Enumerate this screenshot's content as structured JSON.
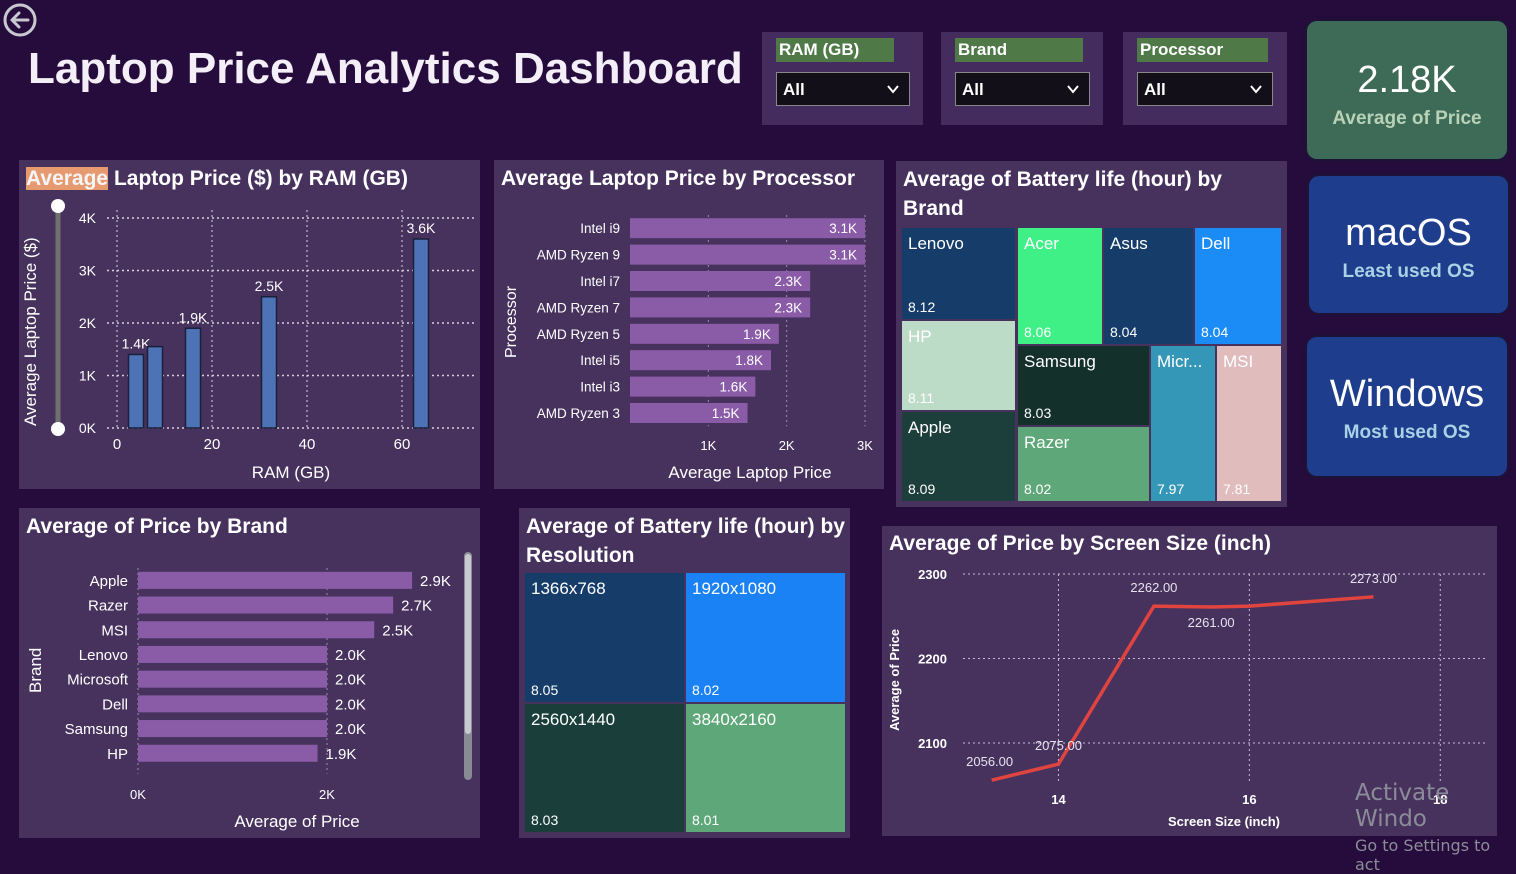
{
  "dashboard_title": "Laptop Price Analytics Dashboard",
  "slicers": [
    {
      "label": "RAM (GB)",
      "value": "All"
    },
    {
      "label": "Brand",
      "value": "All"
    },
    {
      "label": "Processor",
      "value": "All"
    }
  ],
  "kpis": [
    {
      "value": "2.18K",
      "label": "Average of Price",
      "bg": "#3e6b57",
      "label_color": "#b8d2b8"
    },
    {
      "value": "macOS",
      "label": "Least used OS",
      "bg": "#1e3d8c",
      "label_color": "#a9d2e6"
    },
    {
      "value": "Windows",
      "label": "Most used OS",
      "bg": "#1e3d8c",
      "label_color": "#a9d2e6"
    }
  ],
  "ram_chart": {
    "title_highlight": "Average",
    "title_rest": " Laptop Price ($) by RAM (GB)",
    "xlabel": "RAM (GB)",
    "ylabel": "Average Laptop Price ($)",
    "yticks": [
      "0K",
      "1K",
      "2K",
      "3K",
      "4K"
    ],
    "xticks": [
      "0",
      "20",
      "40",
      "60"
    ]
  },
  "proc_chart": {
    "title": "Average Laptop Price by Processor",
    "xlabel": "Average Laptop Price",
    "ylabel": "Processor",
    "xticks": [
      "1K",
      "2K",
      "3K"
    ]
  },
  "battery_brand": {
    "title": "Average of Battery life (hour) by Brand",
    "tiles": [
      {
        "label": "Lenovo",
        "value": "8.12",
        "color": "#163d6a"
      },
      {
        "label": "Acer",
        "value": "8.06",
        "color": "#3ff087"
      },
      {
        "label": "Asus",
        "value": "8.04",
        "color": "#163d6a"
      },
      {
        "label": "Dell",
        "value": "8.04",
        "color": "#1b8cf6"
      },
      {
        "label": "HP",
        "value": "8.11",
        "color": "#bcdcc8"
      },
      {
        "label": "Samsung",
        "value": "8.03",
        "color": "#13302a"
      },
      {
        "label": "Micr...",
        "value": "7.97",
        "color": "#3597b7"
      },
      {
        "label": "MSI",
        "value": "7.81",
        "color": "#e1bcbd"
      },
      {
        "label": "Apple",
        "value": "8.09",
        "color": "#1c3f3b"
      },
      {
        "label": "Razer",
        "value": "8.02",
        "color": "#5ea778"
      }
    ]
  },
  "brand_chart": {
    "title": "Average of Price by Brand",
    "xlabel": "Average of Price",
    "ylabel": "Brand",
    "xticks": [
      "0K",
      "2K"
    ]
  },
  "battery_res": {
    "title": "Average of Battery life (hour) by Resolution",
    "tiles": [
      {
        "label": "1366x768",
        "value": "8.05",
        "color": "#163d6a"
      },
      {
        "label": "1920x1080",
        "value": "8.02",
        "color": "#1b82f6"
      },
      {
        "label": "2560x1440",
        "value": "8.03",
        "color": "#1a3f3a"
      },
      {
        "label": "3840x2160",
        "value": "8.01",
        "color": "#5ea778"
      }
    ]
  },
  "screen_chart": {
    "title": "Average of Price by Screen Size (inch)",
    "xlabel": "Screen Size (inch)",
    "ylabel": "Average of Price",
    "yticks": [
      "2100",
      "2200",
      "2300"
    ],
    "xticks": [
      "14",
      "16",
      "18"
    ]
  },
  "watermark": {
    "line1": "Activate Windo",
    "line2": "Go to Settings to act"
  },
  "chart_data": [
    {
      "type": "bar",
      "title": "Average Laptop Price ($) by RAM (GB)",
      "xlabel": "RAM (GB)",
      "ylabel": "Average Laptop Price ($)",
      "x": [
        4,
        8,
        16,
        32,
        64
      ],
      "values": [
        1400,
        1550,
        1900,
        2500,
        3600
      ],
      "labels": [
        "1.4K",
        "",
        "1.9K",
        "2.5K",
        "3.6K"
      ],
      "xlim": [
        0,
        72
      ],
      "ylim": [
        0,
        4000
      ],
      "grid": true
    },
    {
      "type": "bar",
      "orientation": "horizontal",
      "title": "Average Laptop Price by Processor",
      "xlabel": "Average Laptop Price",
      "ylabel": "Processor",
      "categories": [
        "Intel i9",
        "AMD Ryzen 9",
        "Intel i7",
        "AMD Ryzen 7",
        "AMD Ryzen 5",
        "Intel i5",
        "Intel i3",
        "AMD Ryzen 3"
      ],
      "values": [
        3100,
        3100,
        2300,
        2300,
        1900,
        1800,
        1600,
        1500
      ],
      "labels": [
        "3.1K",
        "3.1K",
        "2.3K",
        "2.3K",
        "1.9K",
        "1.8K",
        "1.6K",
        "1.5K"
      ],
      "xlim": [
        0,
        3000
      ],
      "grid": true
    },
    {
      "type": "bar",
      "orientation": "horizontal",
      "title": "Average of Price by Brand",
      "xlabel": "Average of Price",
      "ylabel": "Brand",
      "categories": [
        "Apple",
        "Razer",
        "MSI",
        "Lenovo",
        "Microsoft",
        "Dell",
        "Samsung",
        "HP"
      ],
      "values": [
        2900,
        2700,
        2500,
        2000,
        2000,
        2000,
        2000,
        1900
      ],
      "labels": [
        "2.9K",
        "2.7K",
        "2.5K",
        "2.0K",
        "2.0K",
        "2.0K",
        "2.0K",
        "1.9K"
      ],
      "xlim": [
        0,
        4000
      ],
      "grid": true
    },
    {
      "type": "line",
      "title": "Average of Price by Screen Size (inch)",
      "xlabel": "Screen Size (inch)",
      "ylabel": "Average of Price",
      "x": [
        13.3,
        14,
        15,
        15.6,
        16,
        17.3
      ],
      "values": [
        2056,
        2075,
        2262,
        2261,
        2262,
        2273
      ],
      "labels": [
        "2056.00",
        "2075.00",
        "2262.00",
        "2261.00",
        "",
        "2273.00"
      ],
      "xlim": [
        13,
        18.5
      ],
      "ylim": [
        2040,
        2300
      ],
      "grid": true
    },
    {
      "type": "treemap",
      "title": "Average of Battery life (hour) by Brand",
      "categories": [
        "Lenovo",
        "HP",
        "Apple",
        "Acer",
        "Samsung",
        "Razer",
        "Asus",
        "Dell",
        "Microsoft",
        "MSI"
      ],
      "values": [
        8.12,
        8.11,
        8.09,
        8.06,
        8.03,
        8.02,
        8.04,
        8.04,
        7.97,
        7.81
      ]
    },
    {
      "type": "treemap",
      "title": "Average of Battery life (hour) by Resolution",
      "categories": [
        "1366x768",
        "1920x1080",
        "2560x1440",
        "3840x2160"
      ],
      "values": [
        8.05,
        8.02,
        8.03,
        8.01
      ]
    }
  ]
}
